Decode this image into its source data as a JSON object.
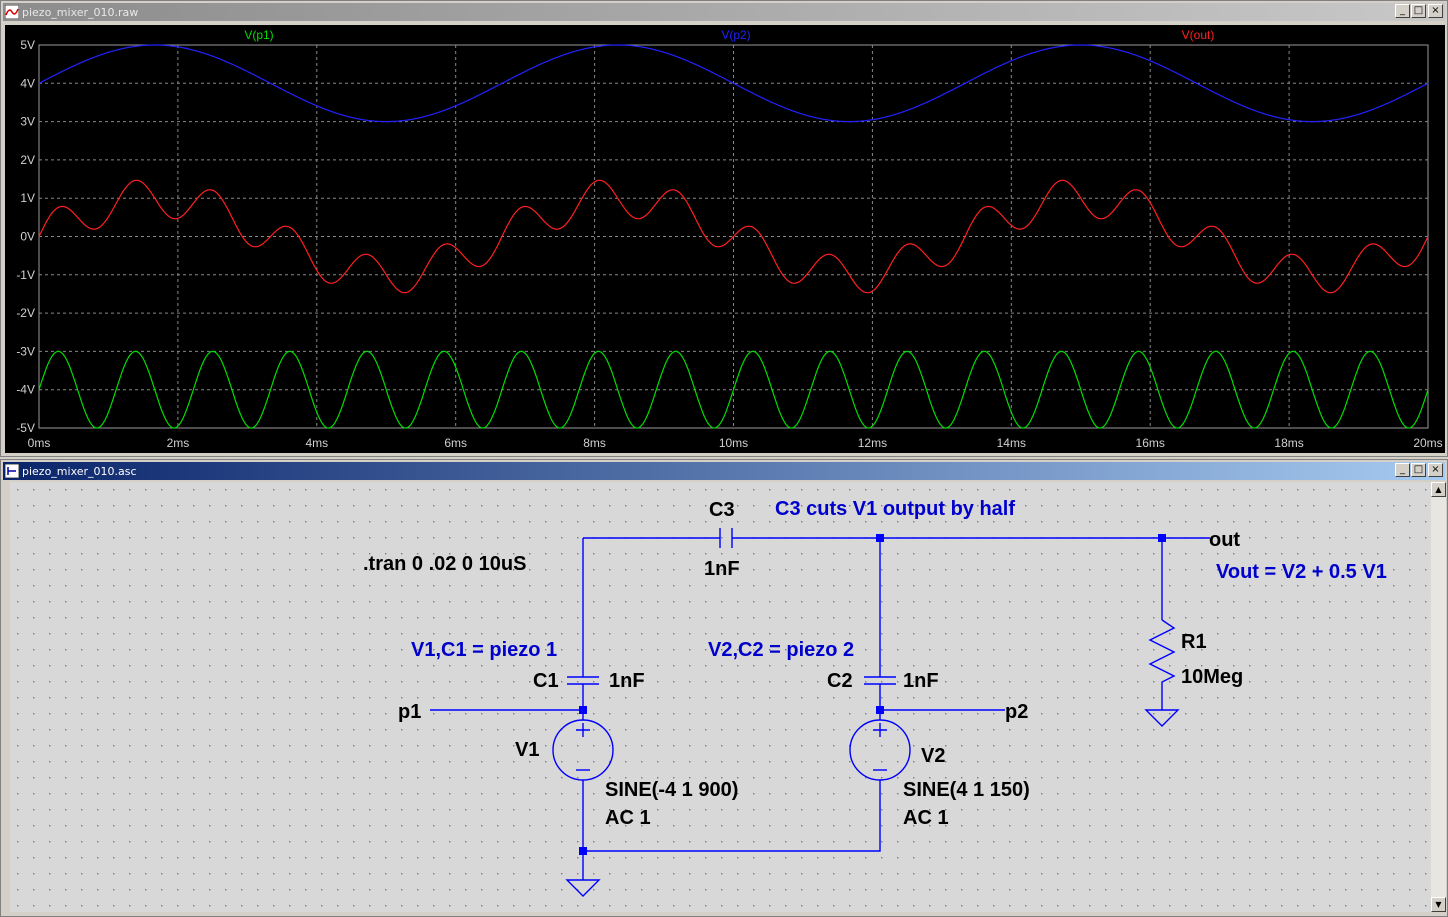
{
  "waveform_window": {
    "title": "piezo_mixer_010.raw"
  },
  "schematic_window": {
    "title": "piezo_mixer_010.asc"
  },
  "window_buttons": {
    "minimize": "_",
    "maximize": "□",
    "close": "×"
  },
  "chart_data": {
    "type": "line",
    "title": "",
    "xlabel": "",
    "ylabel": "",
    "xlim": [
      0,
      20
    ],
    "ylim": [
      -5,
      5
    ],
    "x_unit": "ms",
    "y_unit": "V",
    "grid": true,
    "legend": "top",
    "x_ticks": [
      "0ms",
      "2ms",
      "4ms",
      "6ms",
      "8ms",
      "10ms",
      "12ms",
      "14ms",
      "16ms",
      "18ms",
      "20ms"
    ],
    "y_ticks": [
      "5V",
      "4V",
      "3V",
      "2V",
      "1V",
      "0V",
      "-1V",
      "-2V",
      "-3V",
      "-4V",
      "-5V"
    ],
    "series": [
      {
        "name": "V(p1)",
        "color": "#00dd00",
        "function": "sine",
        "offset": -4,
        "amplitude": 1,
        "freq_hz": 900
      },
      {
        "name": "V(p2)",
        "color": "#2222ff",
        "function": "sine",
        "offset": 4,
        "amplitude": 1,
        "freq_hz": 150
      },
      {
        "name": "V(out)",
        "color": "#ff2020",
        "function": "sum",
        "expression": "0.5*sin(900Hz)+sin(150Hz)"
      }
    ]
  },
  "schematic": {
    "colors": {
      "wire": "#0000ff",
      "text": "#000000",
      "comment": "#0000cc",
      "background": "#d8d8d8"
    },
    "texts": {
      "c3_ref": "C3",
      "c3_value": "1nF",
      "c3_comment": "C3 cuts V1 output by half",
      "tran": ".tran 0 .02 0 10uS",
      "out_label": "out",
      "vout_comment": "Vout = V2 + 0.5 V1",
      "r1_ref": "R1",
      "r1_value": "10Meg",
      "v1c1_comment": "V1,C1 = piezo 1",
      "v2c2_comment": "V2,C2 = piezo 2",
      "c1_ref": "C1",
      "c1_value": "1nF",
      "c2_ref": "C2",
      "c2_value": "1nF",
      "p1_label": "p1",
      "p2_label": "p2",
      "v1_ref": "V1",
      "v1_func": "SINE(-4 1 900)",
      "v1_ac": "AC 1",
      "v2_ref": "V2",
      "v2_func": "SINE(4 1 150)",
      "v2_ac": "AC 1"
    }
  }
}
